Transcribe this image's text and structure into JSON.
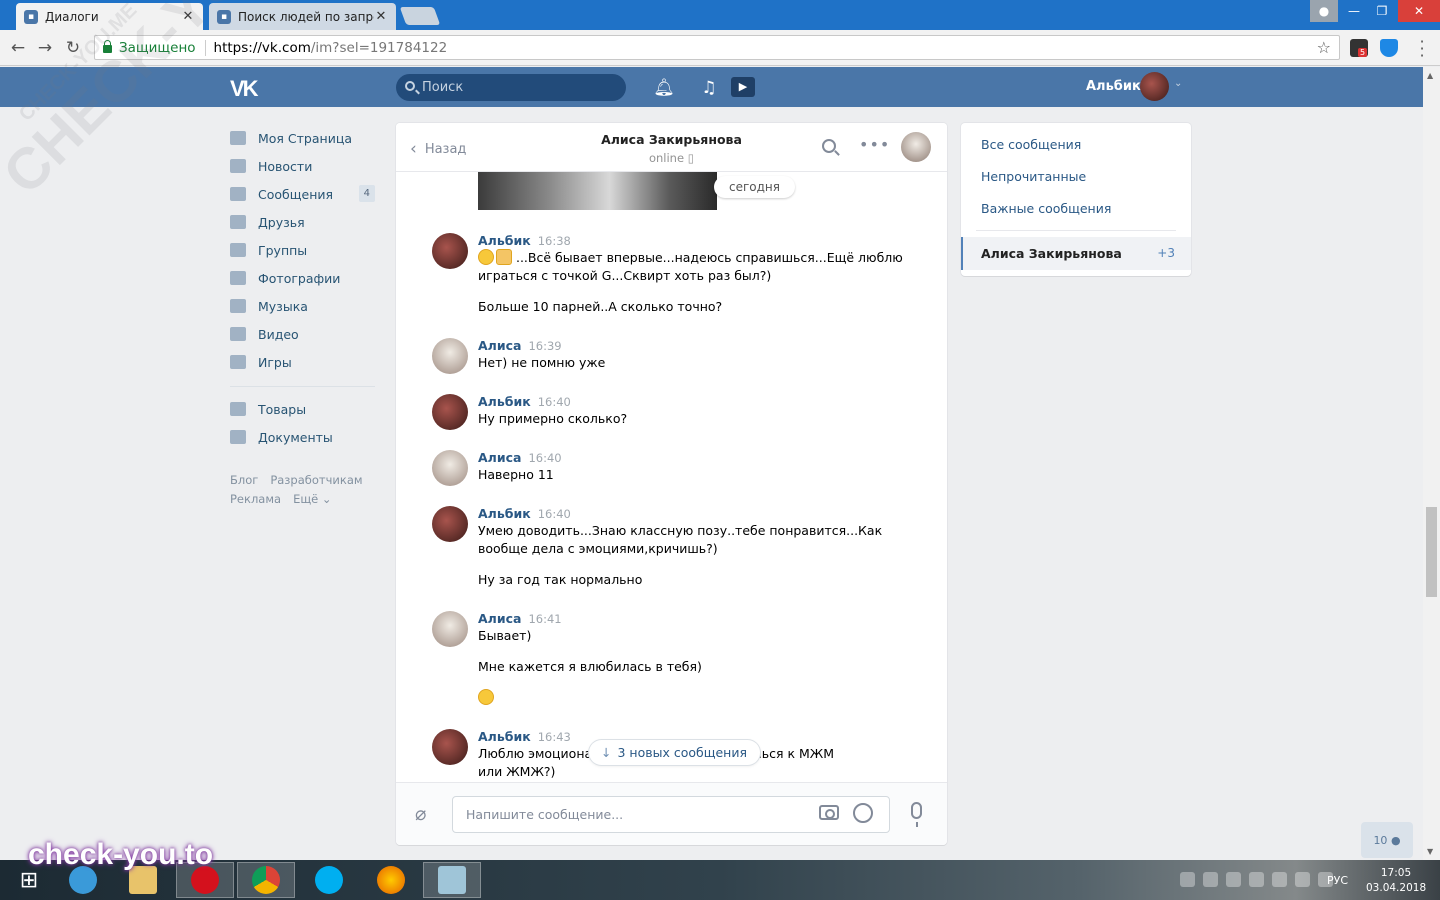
{
  "browser": {
    "tabs": [
      {
        "label": "Диалоги",
        "icon": "vk-favicon"
      },
      {
        "label": "Поиск людей по запрос",
        "icon": "vk-favicon"
      }
    ],
    "secure_label": "Защищено",
    "url_host": "https://vk.com",
    "url_rest": "/im?sel=191784122",
    "ext_badge": "5"
  },
  "vk": {
    "search_placeholder": "Поиск",
    "user_name": "Альбик",
    "logo": "VK"
  },
  "nav": {
    "items": [
      {
        "label": "Моя Страница",
        "icon": "home-icon"
      },
      {
        "label": "Новости",
        "icon": "news-icon"
      },
      {
        "label": "Сообщения",
        "icon": "messages-icon",
        "badge": "4"
      },
      {
        "label": "Друзья",
        "icon": "friends-icon"
      },
      {
        "label": "Группы",
        "icon": "groups-icon"
      },
      {
        "label": "Фотографии",
        "icon": "photo-icon"
      },
      {
        "label": "Музыка",
        "icon": "music-icon"
      },
      {
        "label": "Видео",
        "icon": "video-icon"
      },
      {
        "label": "Игры",
        "icon": "games-icon"
      }
    ],
    "items2": [
      {
        "label": "Товары",
        "icon": "goods-icon"
      },
      {
        "label": "Документы",
        "icon": "docs-icon"
      }
    ],
    "footer": [
      "Блог",
      "Разработчикам",
      "Реклама",
      "Ещё ⌄"
    ]
  },
  "dialog": {
    "back_label": "Назад",
    "contact_name": "Алиса Закирьянова",
    "status": "online ▯",
    "day_label": "сегодня",
    "messages": [
      {
        "author": "Альбик",
        "time": "16:38",
        "lines": [
          "...Всё бывает впервые...надеюсь справишься...Ещё люблю играться с точкой G...Сквирт хоть раз был?)",
          "Больше 10 парней..А сколько точно?"
        ]
      },
      {
        "author": "Алиса",
        "time": "16:39",
        "lines": [
          "Нет) не помню уже"
        ]
      },
      {
        "author": "Альбик",
        "time": "16:40",
        "lines": [
          "Ну примерно сколько?"
        ]
      },
      {
        "author": "Алиса",
        "time": "16:40",
        "lines": [
          "Наверно 11"
        ]
      },
      {
        "author": "Альбик",
        "time": "16:40",
        "lines": [
          "Умею доводить...Знаю классную позу..тебе понравится...Как вообще дела с эмоциями,кричишь?)",
          "Ну за год так нормально"
        ]
      },
      {
        "author": "Алиса",
        "time": "16:41",
        "lines": [
          "Бывает)",
          "Мне кажется я влюбилась в тебя)"
        ]
      },
      {
        "author": "Альбик",
        "time": "16:43",
        "lines": [
          "Люблю эмоциона",
          "ишься к МЖМ",
          "или ЖМЖ?)"
        ]
      }
    ],
    "new_messages_label": "3 новых сообщения",
    "input_placeholder": "Напишите сообщение..."
  },
  "right": {
    "links": [
      "Все сообщения",
      "Непрочитанные",
      "Важные сообщения"
    ],
    "active_name": "Алиса Закирьянова",
    "active_count": "+3"
  },
  "online_count": "10",
  "watermark": {
    "big": "CHECK-YOU.ME",
    "small": "CHECK-YOU.ME",
    "brand": "check-you.to"
  },
  "taskbar": {
    "lang": "РУС",
    "time": "17:05",
    "date": "03.04.2018"
  }
}
